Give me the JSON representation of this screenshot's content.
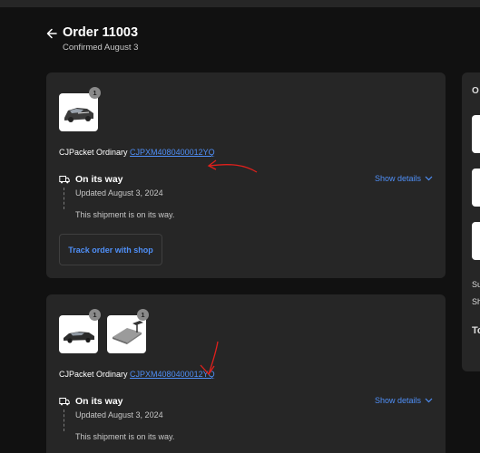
{
  "header": {
    "title": "Order 11003",
    "subtitle": "Confirmed August 3"
  },
  "shipments": [
    {
      "badge_counts": [
        "1"
      ],
      "carrier_label": "CJPacket Ordinary",
      "tracking_number": "CJPXM4080400012YQ",
      "status_title": "On its way",
      "show_details_label": "Show details",
      "updated_text": "Updated August 3, 2024",
      "message": "This shipment is on its way.",
      "track_button_label": "Track order with shop"
    },
    {
      "badge_counts": [
        "1",
        "1"
      ],
      "carrier_label": "CJPacket Ordinary",
      "tracking_number": "CJPXM4080400012YQ",
      "status_title": "On its way",
      "show_details_label": "Show details",
      "updated_text": "Updated August 3, 2024",
      "message": "This shipment is on its way."
    }
  ],
  "side_panel": {
    "heading_initial": "O",
    "row_initial_1": "Su",
    "row_initial_2": "Sh",
    "total_initial": "To"
  },
  "colors": {
    "background": "#111111",
    "card": "#262626",
    "link": "#4f8ff7",
    "annotation": "#e0201c"
  },
  "icons": [
    "back-arrow-icon",
    "truck-icon",
    "chevron-down-icon",
    "car-thumbnail",
    "display-stand-thumbnail"
  ]
}
